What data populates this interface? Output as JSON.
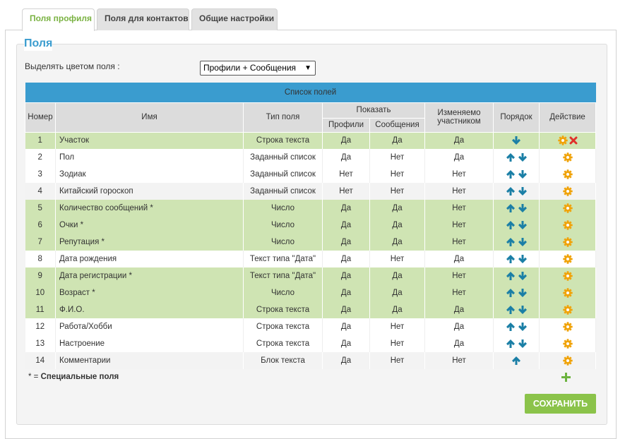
{
  "tabs": [
    {
      "label": "Поля профиля",
      "active": true
    },
    {
      "label": "Поля для контактов",
      "active": false
    },
    {
      "label": "Общие настройки",
      "active": false
    }
  ],
  "panel": {
    "title": "Поля",
    "highlight_label": "Выделять цветом поля :",
    "highlight_value": "Профили + Сообщения"
  },
  "table": {
    "caption": "Список полей",
    "headers": {
      "number": "Номер",
      "name": "Имя",
      "type": "Тип поля",
      "show": "Показать",
      "profiles": "Профили",
      "messages": "Сообщения",
      "editable": "Изменяемо участником",
      "order": "Порядок",
      "action": "Действие"
    },
    "rows": [
      {
        "num": "1",
        "name": "Участок",
        "type": "Строка текста",
        "profiles": "Да",
        "messages": "Да",
        "editable": "Да",
        "style": "g",
        "up": false,
        "down": true,
        "delete": true
      },
      {
        "num": "2",
        "name": "Пол",
        "type": "Заданный список",
        "profiles": "Да",
        "messages": "Нет",
        "editable": "Да",
        "style": "w",
        "up": true,
        "down": true,
        "delete": false
      },
      {
        "num": "3",
        "name": "Зодиак",
        "type": "Заданный список",
        "profiles": "Нет",
        "messages": "Нет",
        "editable": "Нет",
        "style": "w",
        "up": true,
        "down": true,
        "delete": false
      },
      {
        "num": "4",
        "name": "Китайский гороскоп",
        "type": "Заданный список",
        "profiles": "Нет",
        "messages": "Нет",
        "editable": "Нет",
        "style": "l",
        "up": true,
        "down": true,
        "delete": false
      },
      {
        "num": "5",
        "name": "Количество сообщений *",
        "type": "Число",
        "profiles": "Да",
        "messages": "Да",
        "editable": "Нет",
        "style": "g",
        "up": true,
        "down": true,
        "delete": false
      },
      {
        "num": "6",
        "name": "Очки *",
        "type": "Число",
        "profiles": "Да",
        "messages": "Да",
        "editable": "Нет",
        "style": "g",
        "up": true,
        "down": true,
        "delete": false
      },
      {
        "num": "7",
        "name": "Репутация *",
        "type": "Число",
        "profiles": "Да",
        "messages": "Да",
        "editable": "Нет",
        "style": "g",
        "up": true,
        "down": true,
        "delete": false
      },
      {
        "num": "8",
        "name": "Дата рождения",
        "type": "Текст типа \"Дата\"",
        "profiles": "Да",
        "messages": "Нет",
        "editable": "Да",
        "style": "w",
        "up": true,
        "down": true,
        "delete": false
      },
      {
        "num": "9",
        "name": "Дата регистрации *",
        "type": "Текст типа \"Дата\"",
        "profiles": "Да",
        "messages": "Да",
        "editable": "Нет",
        "style": "g",
        "up": true,
        "down": true,
        "delete": false
      },
      {
        "num": "10",
        "name": "Возраст *",
        "type": "Число",
        "profiles": "Да",
        "messages": "Да",
        "editable": "Нет",
        "style": "g",
        "up": true,
        "down": true,
        "delete": false
      },
      {
        "num": "11",
        "name": "Ф.И.О.",
        "type": "Строка текста",
        "profiles": "Да",
        "messages": "Да",
        "editable": "Да",
        "style": "g",
        "up": true,
        "down": true,
        "delete": false
      },
      {
        "num": "12",
        "name": "Работа/Хобби",
        "type": "Строка текста",
        "profiles": "Да",
        "messages": "Нет",
        "editable": "Да",
        "style": "w",
        "up": true,
        "down": true,
        "delete": false
      },
      {
        "num": "13",
        "name": "Настроение",
        "type": "Строка текста",
        "profiles": "Да",
        "messages": "Нет",
        "editable": "Да",
        "style": "w",
        "up": true,
        "down": true,
        "delete": false
      },
      {
        "num": "14",
        "name": "Комментарии",
        "type": "Блок текста",
        "profiles": "Да",
        "messages": "Нет",
        "editable": "Нет",
        "style": "l",
        "up": true,
        "down": false,
        "delete": false
      }
    ]
  },
  "legend": {
    "star": "* =",
    "text": "Специальные поля"
  },
  "save_label": "СОХРАНИТЬ",
  "colors": {
    "accent_blue": "#3a9ccf",
    "active_tab_green": "#7ab242",
    "highlight_row": "#cfe4b3",
    "arrow_teal": "#1b7fa6",
    "gear_orange": "#f0a30a",
    "delete_red": "#e0302a",
    "add_green": "#6cb33f",
    "save_button": "#8bc34a"
  },
  "icons": [
    "arrow-up-icon",
    "arrow-down-icon",
    "gear-icon",
    "delete-icon",
    "add-icon",
    "dropdown-arrow-icon"
  ]
}
